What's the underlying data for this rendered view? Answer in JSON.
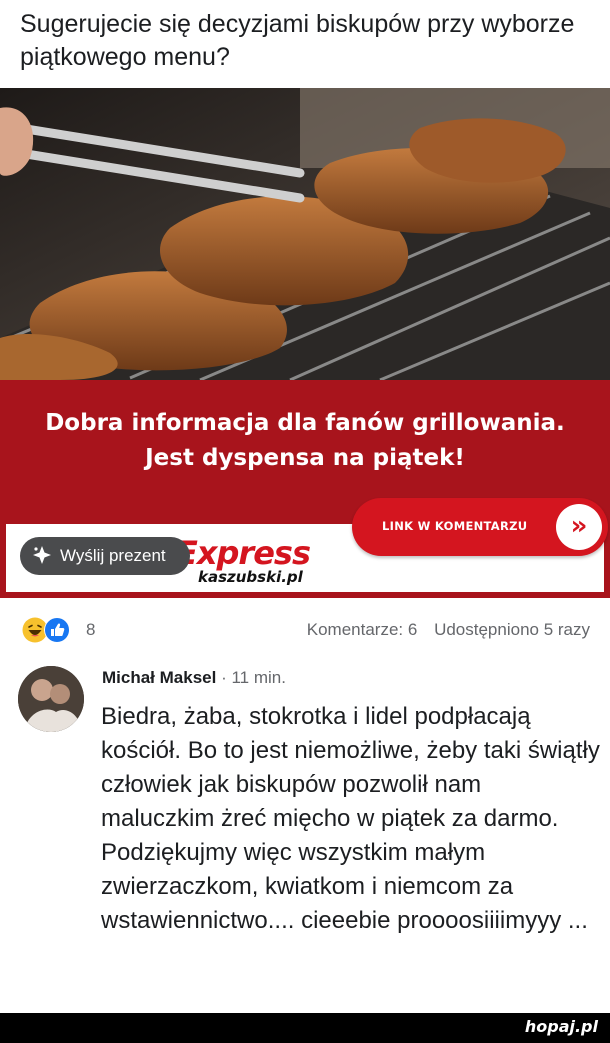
{
  "post": {
    "text": "Sugerujecie się decyzjami biskupów przy wyborze piątkowego menu?"
  },
  "media": {
    "headline_line1": "Dobra informacja dla fanów grillowania.",
    "headline_line2": "Jest dyspensa na piątek!",
    "cta_label": "LINK W KOMENTARZU",
    "cta_arrow": "»",
    "brand_mark": "Express",
    "brand_sub": "kaszubski.pl",
    "gift_button_label": "Wyślij prezent",
    "brand_color": "#d4151f",
    "banner_color": "#a8141c"
  },
  "engagement": {
    "reaction_icons": [
      "haha-icon",
      "like-icon"
    ],
    "reaction_count": "8",
    "comments": "Komentarze: 6",
    "shares": "Udostępniono 5 razy"
  },
  "comment": {
    "author": "Michał Maksel",
    "time": "· 11 min.",
    "paragraph1": "Biedra, żaba, stokrotka i lidel podpłacają kościół. Bo to jest niemożliwe, żeby taki świątły człowiek jak biskupów pozwolił nam maluczkim żreć mięcho w piątek za darmo.",
    "paragraph2": "Podziękujmy więc wszystkim małym zwierzaczkom, kwiatkom i niemcom za wstawiennictwo.... cieeebie proooosiiiimyyy ..."
  },
  "footer": {
    "watermark": "hopaj.pl"
  }
}
